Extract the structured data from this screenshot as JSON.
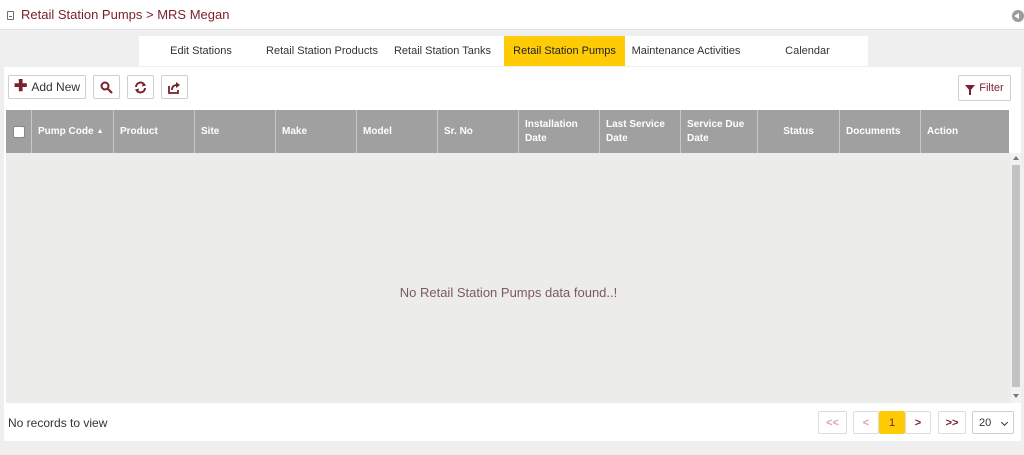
{
  "header": {
    "breadcrumb": "Retail Station Pumps > MRS Megan"
  },
  "tabs": [
    {
      "label": "Edit Stations"
    },
    {
      "label": "Retail Station Products"
    },
    {
      "label": "Retail Station Tanks"
    },
    {
      "label": "Retail Station Pumps",
      "active": true
    },
    {
      "label": "Maintenance Activities"
    },
    {
      "label": "Calendar"
    }
  ],
  "toolbar": {
    "add_new_label": "Add New",
    "search_icon": "search-icon",
    "refresh_icon": "refresh-icon",
    "export_icon": "export-icon",
    "filter_label": "Filter"
  },
  "table": {
    "columns": {
      "pump_code": "Pump Code",
      "product": "Product",
      "site": "Site",
      "make": "Make",
      "model": "Model",
      "sr_no": "Sr. No",
      "installation_date": "Installation Date",
      "last_service_date": "Last Service Date",
      "service_due_date": "Service Due Date",
      "status": "Status",
      "documents": "Documents",
      "action": "Action"
    },
    "empty_message": "No Retail Station Pumps data found..!"
  },
  "footer": {
    "records_text": "No records to view",
    "first_label": "<<",
    "prev_label": "<",
    "current_page": "1",
    "next_label": ">",
    "last_label": ">>",
    "rows_per_page": "20"
  },
  "colors": {
    "accent": "#fecb05",
    "brand": "#7a1f2b",
    "header_bg": "#a0a0a0"
  }
}
